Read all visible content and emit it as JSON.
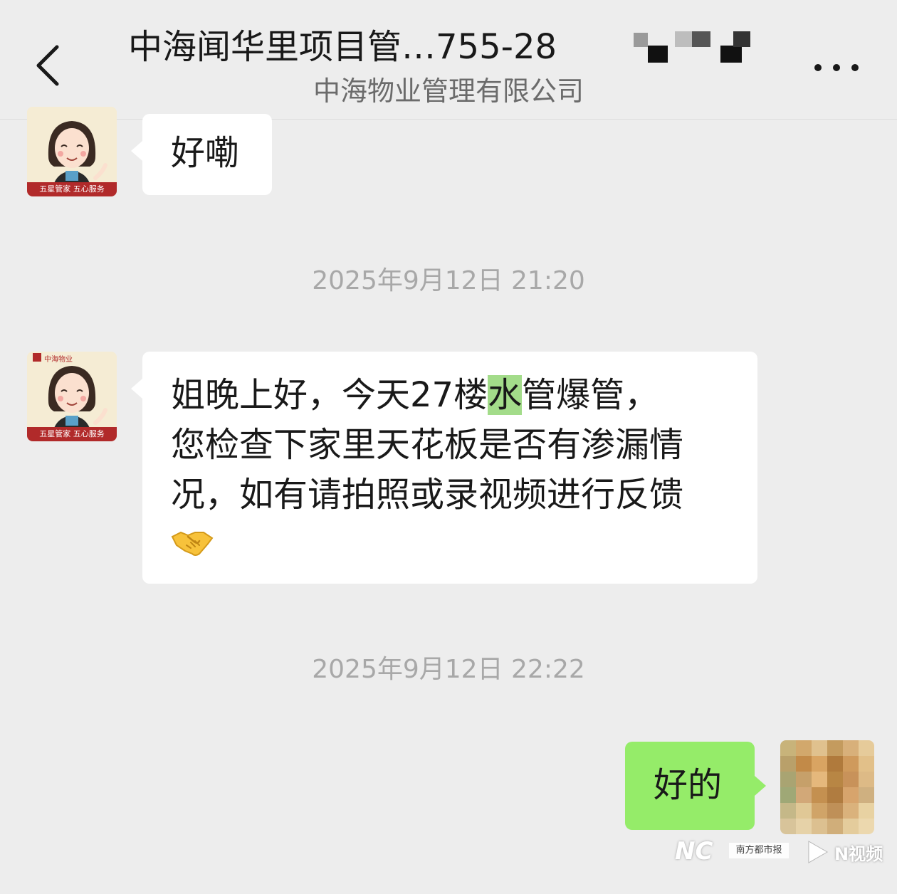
{
  "header": {
    "title": "中海闻华里项目管…755-28",
    "subtitle": "中海物业管理有限公司"
  },
  "avatar_manager": {
    "logo_text": "中海物业",
    "band_text": "五星管家 五心服务"
  },
  "messages": [
    {
      "sender": "manager",
      "text": "好嘞"
    },
    {
      "type": "timestamp",
      "text": "2025年9月12日 21:20"
    },
    {
      "sender": "manager",
      "line1_pre": "姐晚上好，今天27楼",
      "line1_hl": "水",
      "line1_post": "管爆管，",
      "line2": "您检查下家里天花板是否有渗漏情",
      "line3": "况，如有请拍照或录视频进行反馈",
      "emoji": "handshake-emoji"
    },
    {
      "type": "timestamp",
      "text": "2025年9月12日 22:22"
    },
    {
      "sender": "self",
      "text": "好的"
    }
  ],
  "watermark": {
    "left": "NC",
    "badge": "南方都市报",
    "right": "N视频"
  },
  "colors": {
    "background": "#ededed",
    "bubble_in": "#ffffff",
    "bubble_out": "#95ec69",
    "highlight": "#a3dc8a"
  }
}
